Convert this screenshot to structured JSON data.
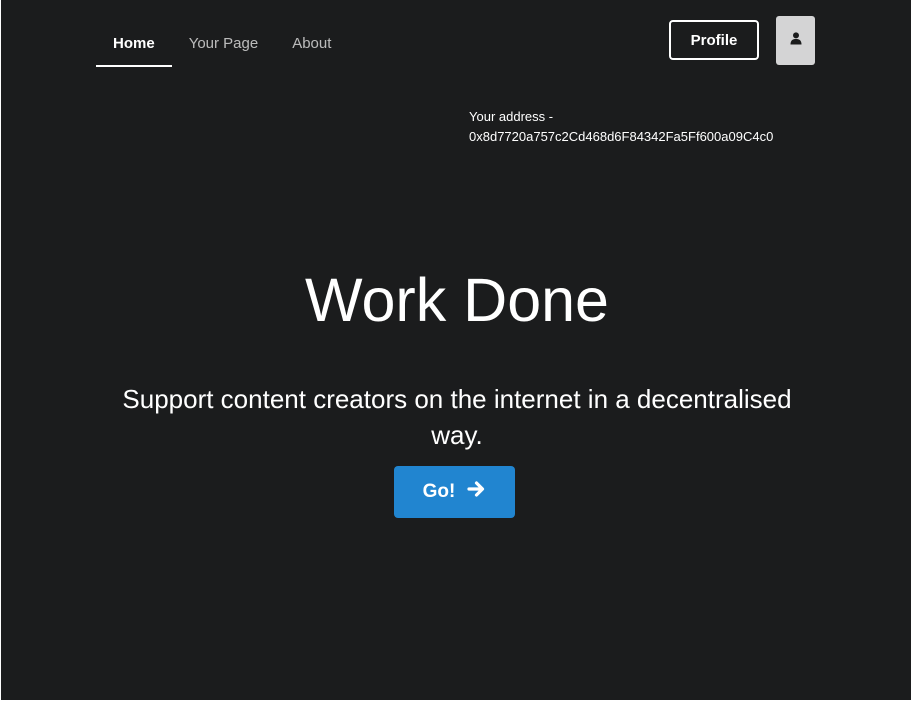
{
  "nav": {
    "items": [
      {
        "label": "Home",
        "active": true
      },
      {
        "label": "Your Page",
        "active": false
      },
      {
        "label": "About",
        "active": false
      }
    ]
  },
  "header": {
    "profile_label": "Profile",
    "avatar_icon": "user-icon"
  },
  "address": {
    "label": "Your address -",
    "value": "0x8d7720a757c2Cd468d6F84342Fa5Ff600a09C4c0"
  },
  "hero": {
    "title": "Work Done",
    "subtitle": "Support content creators on the internet in a decentralised way.",
    "cta_label": "Go!",
    "cta_icon": "arrow-right-icon"
  },
  "colors": {
    "background": "#1b1c1d",
    "primary": "#2185d0",
    "avatar_bg": "#d4d4d5"
  }
}
